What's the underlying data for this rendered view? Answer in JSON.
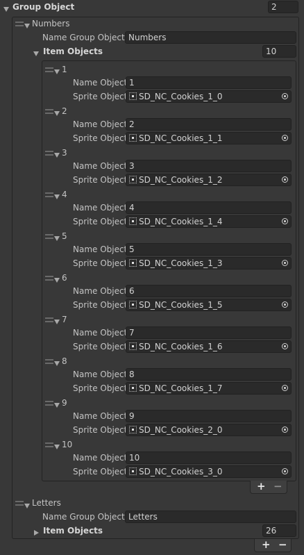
{
  "group": {
    "label": "Group Object",
    "count": "2"
  },
  "numbers": {
    "header": "Numbers",
    "name_label": "Name Group Object",
    "name_value": "Numbers",
    "items_label": "Item Objects",
    "items_count": "10",
    "item_name_label": "Name Object",
    "item_sprite_label": "Sprite Object",
    "items": [
      {
        "index": "1",
        "name": "1",
        "sprite": "SD_NC_Cookies_1_0"
      },
      {
        "index": "2",
        "name": "2",
        "sprite": "SD_NC_Cookies_1_1"
      },
      {
        "index": "3",
        "name": "3",
        "sprite": "SD_NC_Cookies_1_2"
      },
      {
        "index": "4",
        "name": "4",
        "sprite": "SD_NC_Cookies_1_4"
      },
      {
        "index": "5",
        "name": "5",
        "sprite": "SD_NC_Cookies_1_3"
      },
      {
        "index": "6",
        "name": "6",
        "sprite": "SD_NC_Cookies_1_5"
      },
      {
        "index": "7",
        "name": "7",
        "sprite": "SD_NC_Cookies_1_6"
      },
      {
        "index": "8",
        "name": "8",
        "sprite": "SD_NC_Cookies_1_7"
      },
      {
        "index": "9",
        "name": "9",
        "sprite": "SD_NC_Cookies_2_0"
      },
      {
        "index": "10",
        "name": "10",
        "sprite": "SD_NC_Cookies_3_0"
      }
    ]
  },
  "letters": {
    "header": "Letters",
    "name_label": "Name Group Object",
    "name_value": "Letters",
    "items_label": "Item Objects",
    "items_count": "26"
  },
  "buttons": {
    "plus": "+",
    "minus": "−"
  },
  "icons": {
    "sprite": "sprite-asset-icon",
    "picker": "object-picker-icon",
    "handle": "drag-handle-icon",
    "foldout": "foldout-triangle-icon"
  }
}
